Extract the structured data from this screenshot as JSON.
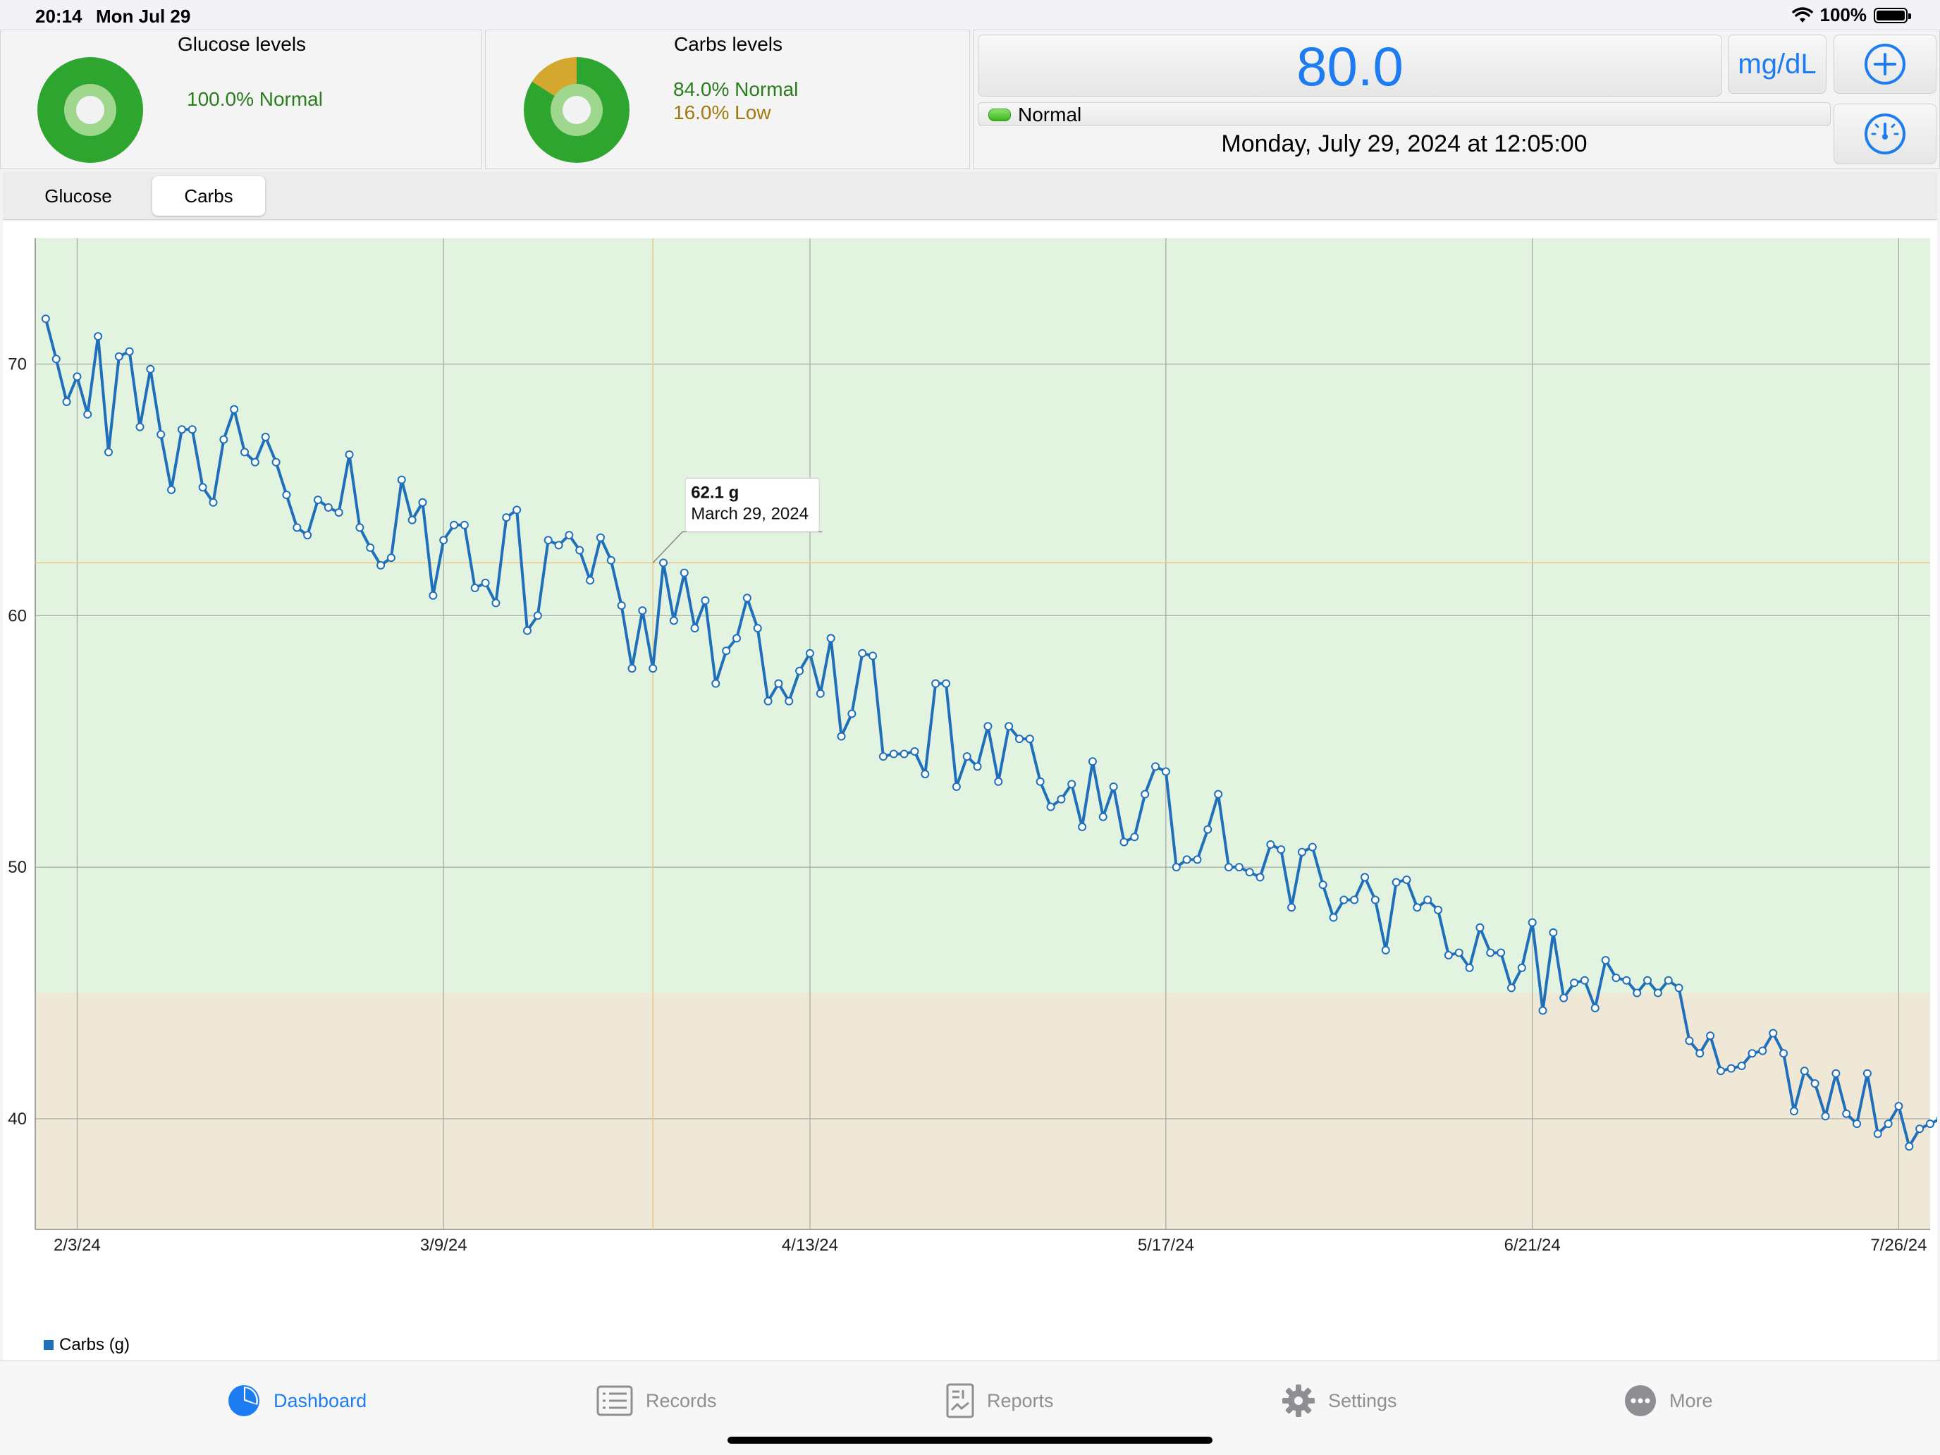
{
  "status_bar": {
    "time": "20:14",
    "date": "Mon Jul 29",
    "battery": "100%"
  },
  "glucose_panel": {
    "title": "Glucose levels",
    "normal_text": "100.0% Normal",
    "normal_fraction": 1.0,
    "colors": {
      "normal": "#2ea52e"
    }
  },
  "carbs_panel": {
    "title": "Carbs levels",
    "normal_text": "84.0% Normal",
    "low_text": "16.0% Low",
    "normal_fraction": 0.84,
    "low_fraction": 0.16,
    "colors": {
      "normal": "#2ea52e",
      "low": "#d4a82e"
    }
  },
  "reading": {
    "value": "80.0",
    "unit": "mg/dL",
    "status": "Normal",
    "timestamp": "Monday, July 29, 2024 at 12:05:00",
    "accent_color": "#1d7cf2"
  },
  "icons": {
    "add": "plus-circle-icon",
    "gauge": "gauge-icon"
  },
  "segmented": {
    "items": [
      {
        "label": "Glucose",
        "active": false
      },
      {
        "label": "Carbs",
        "active": true
      }
    ]
  },
  "chart_data": {
    "type": "line",
    "title": "",
    "xlabel": "",
    "ylabel": "",
    "x_tick_labels": [
      "2/3/24",
      "3/9/24",
      "4/13/24",
      "5/17/24",
      "6/21/24",
      "7/26/24"
    ],
    "x_tick_dates": [
      "2024-02-03",
      "2024-03-09",
      "2024-04-13",
      "2024-05-17",
      "2024-06-21",
      "2024-07-26"
    ],
    "y_ticks": [
      40,
      50,
      60,
      70
    ],
    "ylim": [
      35.6,
      75
    ],
    "xlim": [
      "2024-01-30",
      "2024-07-29"
    ],
    "grid": true,
    "legend_position": "bottom-left",
    "bands": [
      {
        "label": "Normal",
        "from": 45,
        "to": 75,
        "color": "#e2f3e0"
      },
      {
        "label": "Low",
        "from": 35.6,
        "to": 45,
        "color": "#efe8d6"
      }
    ],
    "tooltip": {
      "value_text": "62.1 g",
      "date_text": "March 29, 2024",
      "date": "2024-03-29",
      "value": 62.1
    },
    "series": [
      {
        "name": "Carbs (g)",
        "color": "#1f6fba",
        "start_date": "2024-01-31",
        "step_days": 1,
        "values": [
          71.8,
          70.2,
          68.5,
          69.5,
          68.0,
          71.1,
          66.5,
          70.3,
          70.5,
          67.5,
          69.8,
          67.2,
          65.0,
          67.4,
          67.4,
          65.1,
          64.5,
          67.0,
          68.2,
          66.5,
          66.1,
          67.1,
          66.1,
          64.8,
          63.5,
          63.2,
          64.6,
          64.3,
          64.1,
          66.4,
          63.5,
          62.7,
          62.0,
          62.3,
          65.4,
          63.8,
          64.5,
          60.8,
          63.0,
          63.6,
          63.6,
          61.1,
          61.3,
          60.5,
          63.9,
          64.2,
          59.4,
          60.0,
          63.0,
          62.8,
          63.2,
          62.6,
          61.4,
          63.1,
          62.2,
          60.4,
          57.9,
          60.2,
          57.9,
          62.1,
          59.8,
          61.7,
          59.5,
          60.6,
          57.3,
          58.6,
          59.1,
          60.7,
          59.5,
          56.6,
          57.3,
          56.6,
          57.8,
          58.5,
          56.9,
          59.1,
          55.2,
          56.1,
          58.5,
          58.4,
          54.4,
          54.5,
          54.5,
          54.6,
          53.7,
          57.3,
          57.3,
          53.2,
          54.4,
          54.0,
          55.6,
          53.4,
          55.6,
          55.1,
          55.1,
          53.4,
          52.4,
          52.7,
          53.3,
          51.6,
          54.2,
          52.0,
          53.2,
          51.0,
          51.2,
          52.9,
          54.0,
          53.8,
          50.0,
          50.3,
          50.3,
          51.5,
          52.9,
          50.0,
          50.0,
          49.8,
          49.6,
          50.9,
          50.7,
          48.4,
          50.6,
          50.8,
          49.3,
          48.0,
          48.7,
          48.7,
          49.6,
          48.7,
          46.7,
          49.4,
          49.5,
          48.4,
          48.7,
          48.3,
          46.5,
          46.6,
          46.0,
          47.6,
          46.6,
          46.6,
          45.2,
          46.0,
          47.8,
          44.3,
          47.4,
          44.8,
          45.4,
          45.5,
          44.4,
          46.3,
          45.6,
          45.5,
          45.0,
          45.5,
          45.0,
          45.5,
          45.2,
          43.1,
          42.6,
          43.3,
          41.9,
          42.0,
          42.1,
          42.6,
          42.7,
          43.4,
          42.6,
          40.3,
          41.9,
          41.4,
          40.1,
          41.8,
          40.2,
          39.8,
          41.8,
          39.4,
          39.8,
          40.5,
          38.9,
          39.6,
          39.8,
          40.0
        ]
      }
    ]
  },
  "tab_bar": {
    "items": [
      {
        "label": "Dashboard",
        "icon": "pie-chart-icon",
        "active": true
      },
      {
        "label": "Records",
        "icon": "list-icon",
        "active": false
      },
      {
        "label": "Reports",
        "icon": "report-icon",
        "active": false
      },
      {
        "label": "Settings",
        "icon": "gear-icon",
        "active": false
      },
      {
        "label": "More",
        "icon": "more-icon",
        "active": false
      }
    ]
  }
}
